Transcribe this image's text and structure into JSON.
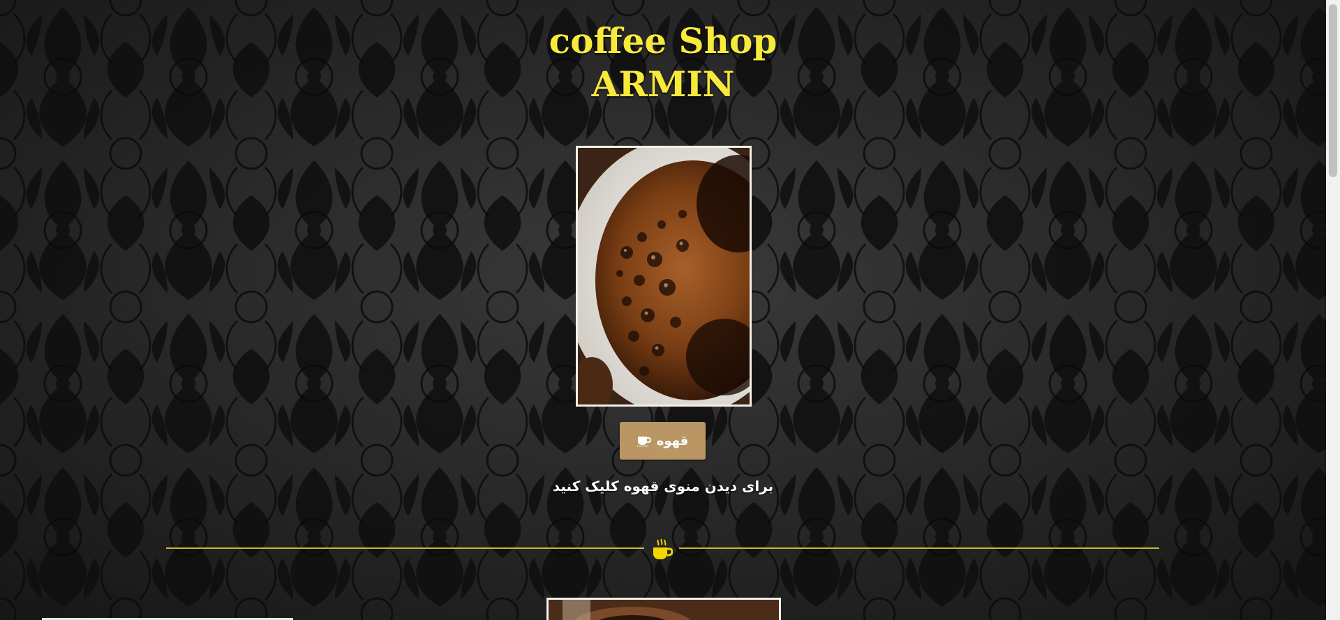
{
  "header": {
    "title_line1": "coffee Shop",
    "title_line2": "ARMIN"
  },
  "hero": {
    "image_name": "coffee-cup-photo"
  },
  "menu_button": {
    "label": "قهوه",
    "icon": "coffee-cup-icon"
  },
  "hint": {
    "text": "برای دیدن منوی قهوه کلیک کنید"
  },
  "divider": {
    "icon": "steaming-coffee-icon"
  },
  "colors": {
    "title": "#f7ea3c",
    "button": "#b99664",
    "divider": "#c9b832",
    "frame": "#f4f0e8",
    "background": "#262626"
  }
}
